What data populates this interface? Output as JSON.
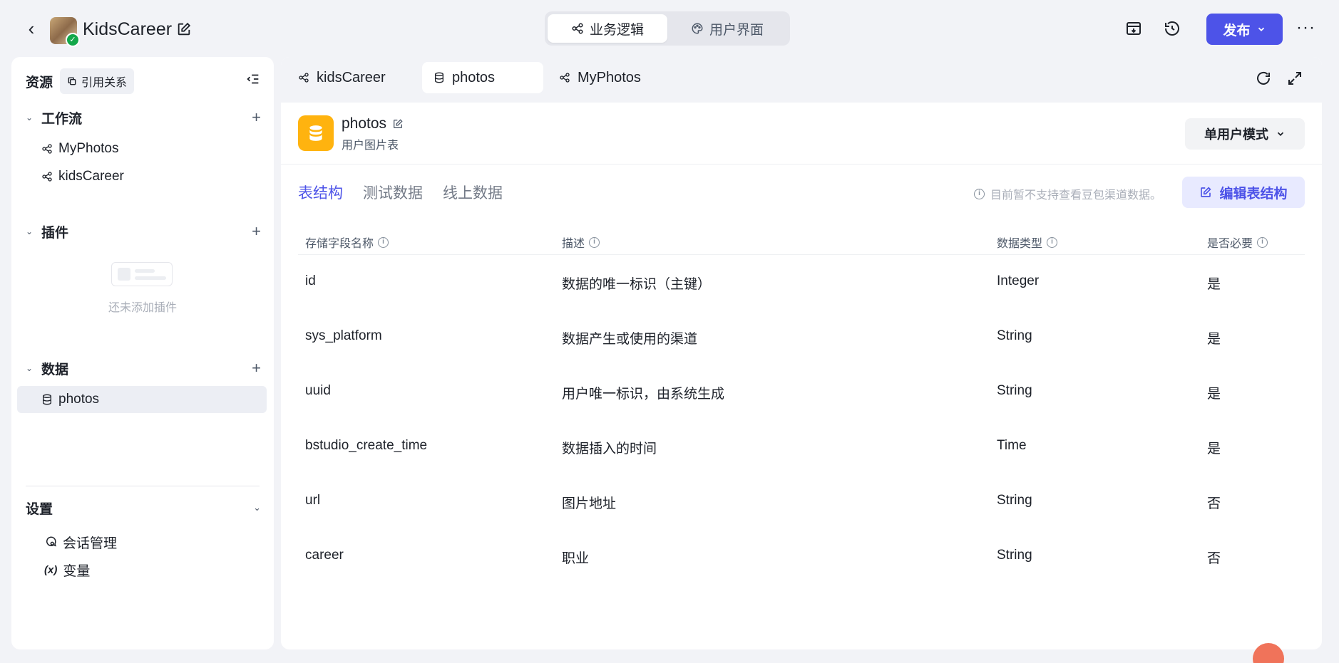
{
  "header": {
    "app_name": "KidsCareer",
    "segments": [
      {
        "label": "业务逻辑",
        "active": true
      },
      {
        "label": "用户界面",
        "active": false
      }
    ],
    "publish_label": "发布",
    "more_label": "···"
  },
  "sidebar": {
    "title": "资源",
    "ref_label": "引用关系",
    "sections": {
      "workflow": {
        "label": "工作流",
        "items": [
          "MyPhotos",
          "kidsCareer"
        ]
      },
      "plugin": {
        "label": "插件",
        "empty_text": "还未添加插件"
      },
      "data": {
        "label": "数据",
        "items": [
          "photos"
        ]
      }
    },
    "settings": {
      "label": "设置",
      "items": [
        {
          "label": "会话管理",
          "icon": "chat-settings-icon"
        },
        {
          "label": "变量",
          "icon": "variable-icon",
          "glyph": "(x)"
        }
      ]
    }
  },
  "tabs": [
    {
      "label": "kidsCareer",
      "icon": "workflow-icon",
      "active": false
    },
    {
      "label": "photos",
      "icon": "database-icon",
      "active": true
    },
    {
      "label": "MyPhotos",
      "icon": "workflow-icon",
      "active": false
    }
  ],
  "resource": {
    "name": "photos",
    "description": "用户图片表",
    "mode": "单用户模式"
  },
  "subtabs": [
    {
      "label": "表结构",
      "active": true
    },
    {
      "label": "测试数据",
      "active": false
    },
    {
      "label": "线上数据",
      "active": false
    }
  ],
  "notice": "目前暂不支持查看豆包渠道数据。",
  "edit_label": "编辑表结构",
  "table": {
    "columns": [
      "存储字段名称",
      "描述",
      "数据类型",
      "是否必要"
    ],
    "rows": [
      {
        "name": "id",
        "desc": "数据的唯一标识（主键）",
        "type": "Integer",
        "required": "是"
      },
      {
        "name": "sys_platform",
        "desc": "数据产生或使用的渠道",
        "type": "String",
        "required": "是"
      },
      {
        "name": "uuid",
        "desc": "用户唯一标识，由系统生成",
        "type": "String",
        "required": "是"
      },
      {
        "name": "bstudio_create_time",
        "desc": "数据插入的时间",
        "type": "Time",
        "required": "是"
      },
      {
        "name": "url",
        "desc": "图片地址",
        "type": "String",
        "required": "否"
      },
      {
        "name": "career",
        "desc": "职业",
        "type": "String",
        "required": "否"
      }
    ]
  },
  "colors": {
    "accent": "#4d53e8",
    "db_icon_bg": "#ffb30f",
    "success": "#13a84b"
  }
}
